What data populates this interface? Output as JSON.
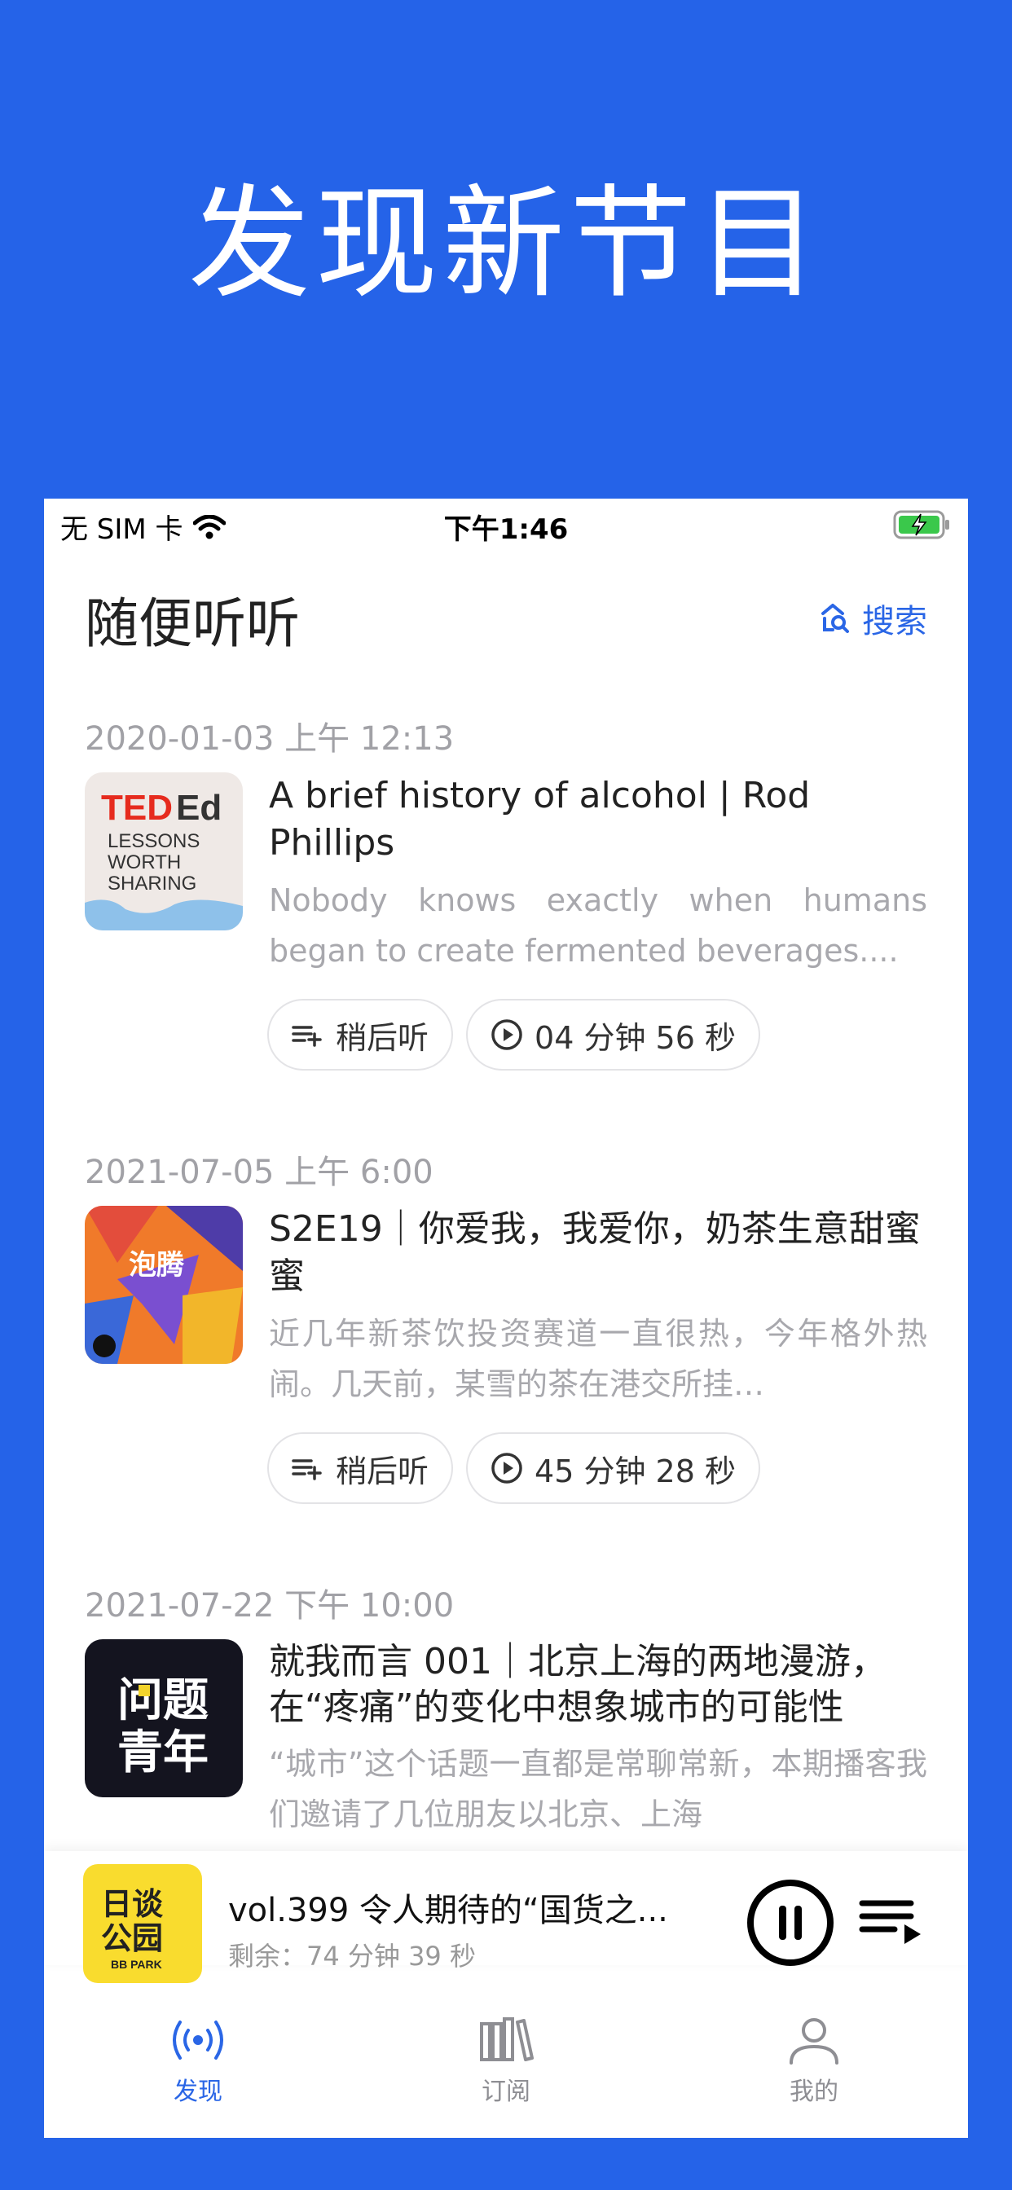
{
  "headline": "发现新节目",
  "status_bar": {
    "carrier": "无 SIM 卡",
    "time": "下午1:46"
  },
  "nav": {
    "title": "随便听听",
    "search_label": "搜索"
  },
  "episodes": [
    {
      "date": "2020-01-03 上午 12:13",
      "title": "A brief history of alcohol | Rod Phillips",
      "description": "Nobody knows exactly when humans began to create fermented beverages....",
      "cover": "TEDEd LESSONS WORTH SHARING",
      "later_label": "稍后听",
      "duration": "04 分钟 56 秒"
    },
    {
      "date": "2021-07-05 上午 6:00",
      "title": "S2E19｜你爱我，我爱你，奶茶生意甜蜜蜜",
      "description": "近几年新茶饮投资赛道一直很热，今年格外热闹。几天前，某雪的茶在港交所挂…",
      "cover": "泡腾",
      "later_label": "稍后听",
      "duration": "45 分钟 28 秒"
    },
    {
      "date": "2021-07-22 下午 10:00",
      "title": "就我而言 001｜北京上海的两地漫游，在“疼痛”的变化中想象城市的可能性",
      "description": "“城市”这个话题一直都是常聊常新，本期播客我们邀请了几位朋友以北京、上海",
      "cover": "问题青年"
    }
  ],
  "player": {
    "title": "vol.399 令人期待的“国货之...",
    "remaining": "剩余：74 分钟 39 秒",
    "cover": "日谈公园 BB PARK"
  },
  "tabs": [
    {
      "label": "发现",
      "icon": "broadcast-icon",
      "active": true
    },
    {
      "label": "订阅",
      "icon": "library-icon",
      "active": false
    },
    {
      "label": "我的",
      "icon": "person-icon",
      "active": false
    }
  ],
  "colors": {
    "background": "#2563e8",
    "accent": "#2a66e6"
  }
}
